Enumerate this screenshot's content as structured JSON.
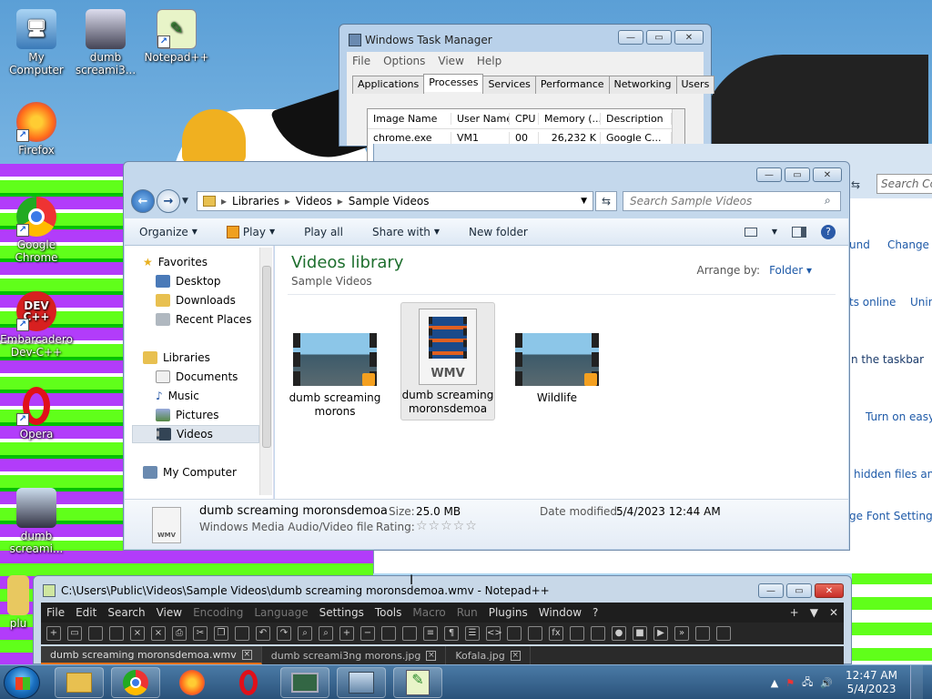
{
  "desktop": {
    "icons": [
      {
        "label": "My Computer"
      },
      {
        "label": "dumb screami3..."
      },
      {
        "label": "Notepad++"
      },
      {
        "label": "Firefox"
      },
      {
        "label": "Google Chrome"
      },
      {
        "label": "Embarcadero Dev-C++"
      },
      {
        "label": "Opera"
      },
      {
        "label": "dumb screami..."
      },
      {
        "label": "plu"
      }
    ],
    "devcpp_badge": "DEV C++"
  },
  "task_manager": {
    "title": "Windows Task Manager",
    "menu": [
      "File",
      "Options",
      "View",
      "Help"
    ],
    "tabs": [
      "Applications",
      "Processes",
      "Services",
      "Performance",
      "Networking",
      "Users"
    ],
    "active_tab": "Processes",
    "columns": [
      "Image Name",
      "User Name",
      "CPU",
      "Memory (...",
      "Description"
    ],
    "rows": [
      [
        "chrome.exe",
        "VM1",
        "00",
        "26,232 K",
        "Google C..."
      ]
    ]
  },
  "control_panel": {
    "search_placeholder": "Search Con",
    "links": [
      "und",
      "Change s",
      "ts online",
      "Unin",
      "n the taskbar",
      "Turn on easy a",
      "hidden files and",
      "ge Font Settings"
    ]
  },
  "explorer": {
    "breadcrumb": [
      "Libraries",
      "Videos",
      "Sample Videos"
    ],
    "search_placeholder": "Search Sample Videos",
    "toolbar": {
      "organize": "Organize",
      "play": "Play",
      "play_all": "Play all",
      "share_with": "Share with",
      "new_folder": "New folder"
    },
    "nav": {
      "favorites": "Favorites",
      "desktop": "Desktop",
      "downloads": "Downloads",
      "recent": "Recent Places",
      "libraries": "Libraries",
      "documents": "Documents",
      "music": "Music",
      "pictures": "Pictures",
      "videos": "Videos",
      "computer": "My Computer"
    },
    "library_title": "Videos library",
    "library_subtitle": "Sample Videos",
    "arrange_label": "Arrange by:",
    "arrange_value": "Folder",
    "files": [
      {
        "name": "dumb screaming morons"
      },
      {
        "name": "dumb screaming moronsdemoa",
        "badge": "WMV"
      },
      {
        "name": "Wildlife"
      }
    ],
    "details": {
      "name": "dumb screaming moronsdemoa",
      "type": "Windows Media Audio/Video file",
      "size_label": "Size:",
      "size_value": "25.0 MB",
      "rating_label": "Rating:",
      "rating_stars": "☆☆☆☆☆",
      "date_label": "Date modified:",
      "date_value": "5/4/2023 12:44 AM",
      "icon_badge": "WMV"
    }
  },
  "notepadpp": {
    "title": "C:\\Users\\Public\\Videos\\Sample Videos\\dumb screaming moronsdemoa.wmv - Notepad++",
    "menu": [
      "File",
      "Edit",
      "Search",
      "View",
      "Encoding",
      "Language",
      "Settings",
      "Tools",
      "Macro",
      "Run",
      "Plugins",
      "Window",
      "?"
    ],
    "tabs": [
      "dumb screaming moronsdemoa.wmv",
      "dumb screami3ng morons.jpg",
      "Kofala.jpg"
    ],
    "right_controls": [
      "+",
      "▼",
      "✕"
    ]
  },
  "taskbar": {
    "time": "12:47 AM",
    "date": "5/4/2023"
  },
  "colors": {
    "library_title": "#1e6f2e",
    "link": "#1e5aa8",
    "close_button": "#c8302a"
  }
}
